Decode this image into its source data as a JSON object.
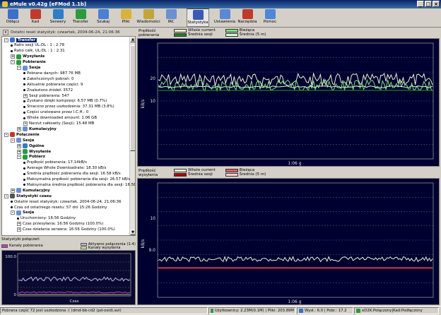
{
  "window": {
    "title": "eMule v0.42g [eFMod 1.1b]"
  },
  "toolbar": {
    "items": [
      {
        "label": "Odłącz",
        "icon": "disconnect-icon",
        "color": "#3b6fc9"
      },
      {
        "label": "Kad",
        "icon": "kad-icon",
        "color": "#c23a2b"
      },
      {
        "label": "Serwery",
        "icon": "servers-icon",
        "color": "#2e7dc9"
      },
      {
        "label": "Transfer",
        "icon": "transfer-icon",
        "color": "#2d9a3e"
      },
      {
        "label": "Szukaj",
        "icon": "search-icon",
        "color": "#4a7fd1"
      },
      {
        "label": "Pliki",
        "icon": "files-icon",
        "color": "#d8b23a"
      },
      {
        "label": "Wiadomości",
        "icon": "messages-icon",
        "color": "#c4a43a"
      },
      {
        "label": "IRC",
        "icon": "irc-icon",
        "color": "#6b8fd0"
      },
      {
        "label": "Statystyka",
        "icon": "statistics-icon",
        "color": "#3a58b5"
      },
      {
        "label": "Ustawienia",
        "icon": "settings-icon",
        "color": "#5b87d6"
      },
      {
        "label": "Narzędzia",
        "icon": "tools-icon",
        "color": "#c0392b"
      },
      {
        "label": "Pomoc",
        "icon": "help-icon",
        "color": "#4f86d8"
      }
    ]
  },
  "left_header": "Ostatni reset statystyk: czwartek, 2004-06-24, 21:06:36",
  "tree": [
    {
      "text": "Transfer",
      "level": 0,
      "kind": "sel",
      "box": "-",
      "icon": "#3b6fc9"
    },
    {
      "text": "Ratio sesji UL:DL : 1 : 2.78",
      "level": 1,
      "kind": "dot"
    },
    {
      "text": "Ratio całk. UL:DL : 1 : 2.31",
      "level": 1,
      "kind": "dot"
    },
    {
      "text": "Wysyłanie",
      "level": 1,
      "kind": "b",
      "box": "+",
      "icon": "#2d9a3e"
    },
    {
      "text": "Pobieranie",
      "level": 1,
      "kind": "b",
      "box": "-",
      "icon": "#2d9a3e"
    },
    {
      "text": "Sesja",
      "level": 2,
      "kind": "b",
      "box": "-",
      "icon": "#6b8fd0"
    },
    {
      "text": "Pobrane danych: 987.76 MB",
      "level": 3,
      "kind": "dot"
    },
    {
      "text": "Zakończonych pobrań: 0",
      "level": 3,
      "kind": "dot"
    },
    {
      "text": "Aktualnie pobierane części: 9",
      "level": 3,
      "kind": "dot"
    },
    {
      "text": "Znaleziono źródeł: 3572",
      "level": 3,
      "kind": "dot"
    },
    {
      "text": "Sesji pobierania: 547",
      "level": 3,
      "kind": "box",
      "box": "+"
    },
    {
      "text": "Zyskano dzięki kompresji: 6.57 MB (0.7%)",
      "level": 3,
      "kind": "dot"
    },
    {
      "text": "Stracono przez uszkodzenia: 37.31 MB (3.8%)",
      "level": 3,
      "kind": "dot"
    },
    {
      "text": "Części uratowane przez I.C.H.: 0",
      "level": 3,
      "kind": "dot"
    },
    {
      "text": "Whole downloaded amount: 1.06 GB",
      "level": 3,
      "kind": "dot"
    },
    {
      "text": "Narzut całkowity (Sesji): 15.48 MB",
      "level": 3,
      "kind": "box",
      "box": "+"
    },
    {
      "text": "Kumulacyjny",
      "level": 2,
      "kind": "b",
      "box": "+",
      "icon": "#6b8fd0"
    },
    {
      "text": "Połączenie",
      "level": 0,
      "kind": "b",
      "box": "-",
      "icon": "#c0392b"
    },
    {
      "text": "Sesja",
      "level": 1,
      "kind": "b",
      "box": "-",
      "icon": "#6b8fd0"
    },
    {
      "text": "Ogólne",
      "level": 2,
      "kind": "b",
      "box": "+",
      "icon": "#2e7dc9"
    },
    {
      "text": "Wysyłanie",
      "level": 2,
      "kind": "b",
      "box": "+",
      "icon": "#2d9a3e"
    },
    {
      "text": "Pobierz",
      "level": 2,
      "kind": "b",
      "box": "-",
      "icon": "#2d9a3e"
    },
    {
      "text": "Prędkość pobierania: 17.14kB/s",
      "level": 3,
      "kind": "dot"
    },
    {
      "text": "Average Whole Downloadrate: 18.30 kB/s",
      "level": 3,
      "kind": "dot"
    },
    {
      "text": "Średnia prędkość pobierania dla sesji: 16.58 kB/s",
      "level": 3,
      "kind": "dot"
    },
    {
      "text": "Maksymalna prędkość pobierania dla sesji: 26.57 kB/s",
      "level": 3,
      "kind": "dot"
    },
    {
      "text": "Maksymalna średnia prędkość pobierania dla sesji: 16.58",
      "level": 3,
      "kind": "dot"
    },
    {
      "text": "Kumulacyjny",
      "level": 1,
      "kind": "b",
      "box": "+",
      "icon": "#6b8fd0"
    },
    {
      "text": "Statystyki czasu",
      "level": 0,
      "kind": "b",
      "box": "-",
      "icon": "#555555"
    },
    {
      "text": "Ostatni reset statystyk: czwartek, 2004-06-24, 21:06:36",
      "level": 1,
      "kind": "dot"
    },
    {
      "text": "Czas od ostatniego resetu: 57 dni 15:26 Godziny",
      "level": 1,
      "kind": "dot"
    },
    {
      "text": "Sesja",
      "level": 1,
      "kind": "b",
      "box": "-",
      "icon": "#6b8fd0"
    },
    {
      "text": "Uruchomiony: 16:56 Godziny",
      "level": 2,
      "kind": "dot"
    },
    {
      "text": "Czas przesyłania: 16:56 Godziny (100.0%)",
      "level": 2,
      "kind": "box",
      "box": "+"
    },
    {
      "text": "Czas działania serwera: 16:56 Godziny (100.0%)",
      "level": 2,
      "kind": "box",
      "box": "+"
    }
  ],
  "connections": {
    "title": "Statystyki połączeń",
    "legend": [
      {
        "label": "Aktywne połączenia (1:4)",
        "color": "#b4b6e8"
      },
      {
        "label": "Kanały pobierania",
        "color": "#c040c0"
      },
      {
        "label": "Kanały wysyłania",
        "color": "#f0f0a0"
      }
    ],
    "y_top": "100.0",
    "y_bottom": "0",
    "x_label": "Czas"
  },
  "download_graph": {
    "title": "Prędkość pobierania",
    "legend": [
      {
        "label": "Whole current",
        "color": "#f0f0d0"
      },
      {
        "label": "Bieżąca",
        "color": "#7fe07f"
      },
      {
        "label": "Średnia sesji",
        "color": "#208020"
      },
      {
        "label": "Średnia (5 m)",
        "color": "#d0ffd0"
      }
    ],
    "ylabel": "kB/s",
    "y_ticks": [
      "20",
      "10"
    ],
    "x_label": "1:06 g"
  },
  "upload_graph": {
    "title": "Prędkość wysyłania",
    "legend": [
      {
        "label": "Whole current",
        "color": "#f0f0d0"
      },
      {
        "label": "Bieżąca",
        "color": "#e06060"
      },
      {
        "label": "Średnia sesji",
        "color": "#b00000"
      },
      {
        "label": "Średnia (5 m)",
        "color": "#ffd0d0"
      }
    ],
    "ylabel": "kB/s",
    "y_ticks": [
      "10",
      "9.0"
    ],
    "x_label": "1:06 g"
  },
  "status": {
    "msg": "Pobrana część 72 jest uszkodzona :( (dmd-bb-cd2 (pd-osid).avi)",
    "users": "Użytkownicy: 2.23M(0.1M) | Pliki: 203.89M",
    "speed": "Wysł.: 6.0 | Pobr.: 17.2",
    "connection": "eD2K:Połączony|Kad:Podłączony"
  }
}
